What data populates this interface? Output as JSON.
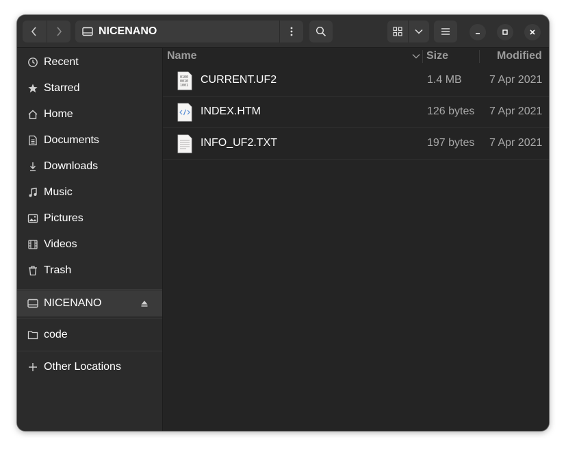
{
  "header": {
    "path_label": "NICENANO"
  },
  "sidebar": {
    "items": [
      {
        "label": "Recent",
        "icon": "clock-icon"
      },
      {
        "label": "Starred",
        "icon": "star-icon"
      },
      {
        "label": "Home",
        "icon": "home-icon"
      },
      {
        "label": "Documents",
        "icon": "document-icon"
      },
      {
        "label": "Downloads",
        "icon": "download-icon"
      },
      {
        "label": "Music",
        "icon": "music-icon"
      },
      {
        "label": "Pictures",
        "icon": "picture-icon"
      },
      {
        "label": "Videos",
        "icon": "video-icon"
      },
      {
        "label": "Trash",
        "icon": "trash-icon"
      }
    ],
    "devices": [
      {
        "label": "NICENANO",
        "icon": "drive-icon",
        "selected": true
      }
    ],
    "bookmarks": [
      {
        "label": "code",
        "icon": "folder-icon"
      }
    ],
    "other": {
      "label": "Other Locations",
      "icon": "plus-icon"
    }
  },
  "columns": {
    "name": "Name",
    "size": "Size",
    "modified": "Modified"
  },
  "files": [
    {
      "name": "CURRENT.UF2",
      "size": "1.4 MB",
      "modified": "7 Apr 2021",
      "icon": "binary-file-icon"
    },
    {
      "name": "INDEX.HTM",
      "size": "126 bytes",
      "modified": "7 Apr 2021",
      "icon": "html-file-icon"
    },
    {
      "name": "INFO_UF2.TXT",
      "size": "197 bytes",
      "modified": "7 Apr 2021",
      "icon": "text-file-icon"
    }
  ],
  "colors": {
    "window_bg": "#242424",
    "sidebar_bg": "#2b2b2b",
    "headerbar_bg": "#303030",
    "selected_bg": "#3a3a3a"
  }
}
